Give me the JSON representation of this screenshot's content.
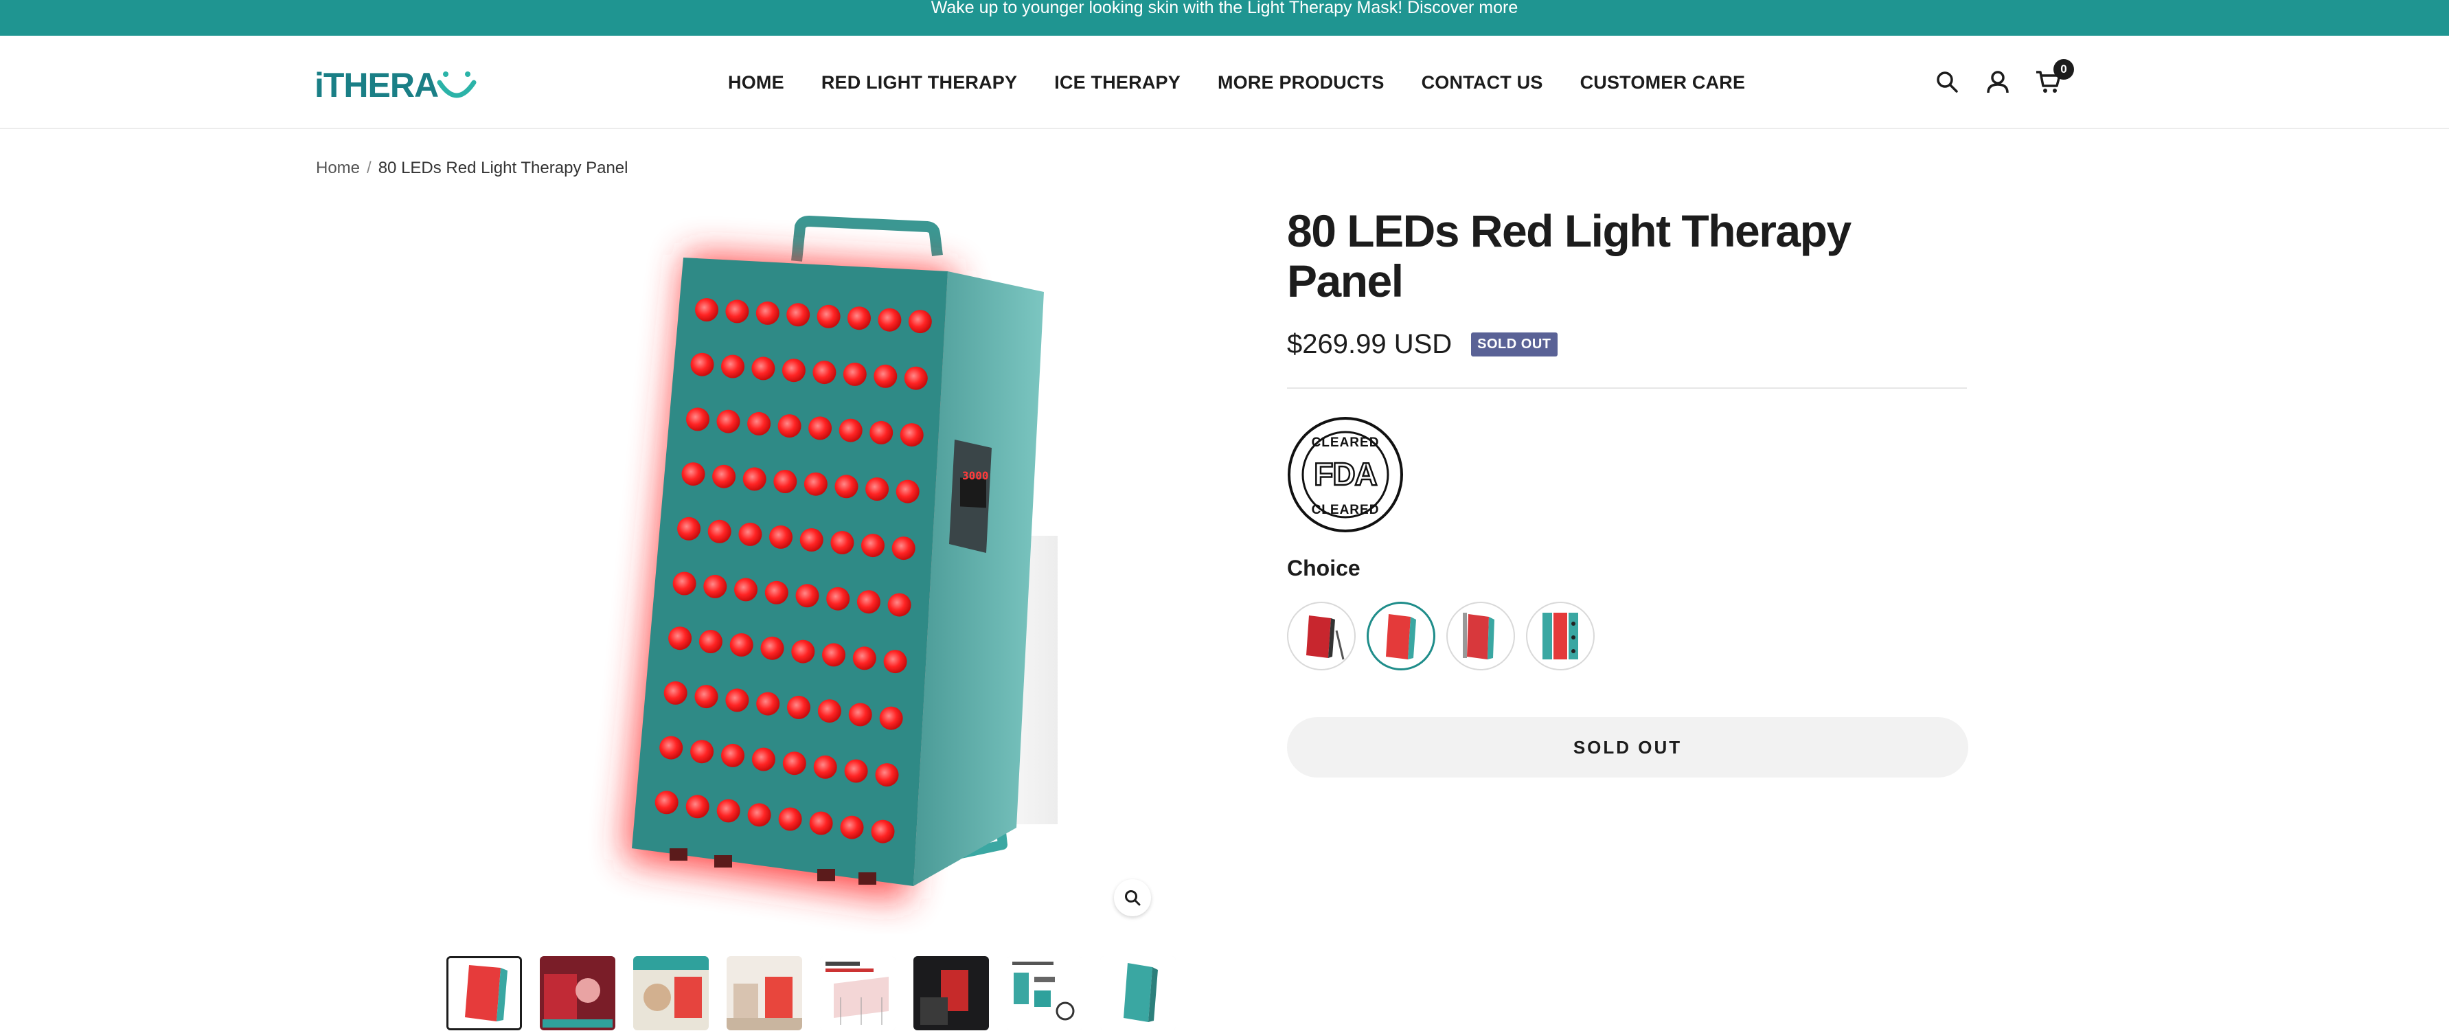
{
  "announcement": {
    "text": "Wake up to younger looking skin with the Light Therapy Mask! Discover more"
  },
  "header": {
    "logo_text": "iTHERA",
    "nav": [
      "HOME",
      "RED LIGHT THERAPY",
      "ICE THERAPY",
      "MORE PRODUCTS",
      "CONTACT US",
      "CUSTOMER CARE"
    ],
    "icons": [
      "search-icon",
      "account-icon",
      "cart-icon"
    ],
    "cart_count": "0"
  },
  "breadcrumb": {
    "home": "Home",
    "separator": "/",
    "current": "80 LEDs Red Light Therapy Panel"
  },
  "product": {
    "title": "80 LEDs Red Light Therapy Panel",
    "price": "$269.99 USD",
    "badge": "SOLD OUT",
    "fda_top": "CLEARED",
    "fda_mid": "FDA",
    "fda_bottom": "CLEARED",
    "choice_label": "Choice",
    "swatch_count": 4,
    "selected_swatch": 2,
    "button_label": "SOLD OUT",
    "panel_display": "3000",
    "thumbnail_count": 8,
    "active_thumbnail": 1
  },
  "colors": {
    "brand_teal": "#1f9591",
    "led_red": "#ff2a2a",
    "badge": "#5a6296"
  }
}
